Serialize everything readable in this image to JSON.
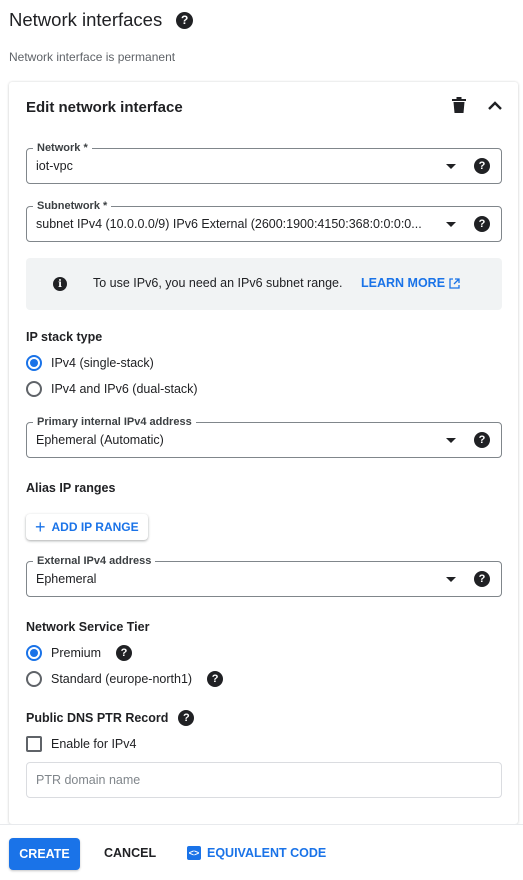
{
  "header": {
    "title": "Network interfaces",
    "subtitle": "Network interface is permanent"
  },
  "card": {
    "title": "Edit network interface",
    "network": {
      "label": "Network *",
      "value": "iot-vpc"
    },
    "subnetwork": {
      "label": "Subnetwork *",
      "value": "subnet IPv4 (10.0.0.0/9)  IPv6 External (2600:1900:4150:368:0:0:0:0..."
    },
    "info": {
      "text": "To use IPv6, you need an IPv6 subnet range.",
      "link": "LEARN MORE"
    },
    "ip_stack": {
      "label": "IP stack type",
      "options": [
        "IPv4 (single-stack)",
        "IPv4 and IPv6 (dual-stack)"
      ],
      "selected": "IPv4 (single-stack)"
    },
    "primary_ip": {
      "label": "Primary internal IPv4 address",
      "value": "Ephemeral (Automatic)"
    },
    "alias": {
      "label": "Alias IP ranges",
      "add_button": "ADD IP RANGE"
    },
    "external_ip": {
      "label": "External IPv4 address",
      "value": "Ephemeral"
    },
    "tier": {
      "label": "Network Service Tier",
      "options": [
        "Premium",
        "Standard (europe-north1)"
      ],
      "selected": "Premium"
    },
    "dns": {
      "label": "Public DNS PTR Record",
      "checkbox_label": "Enable for IPv4",
      "checked": false,
      "placeholder": "PTR domain name"
    }
  },
  "footer": {
    "create": "CREATE",
    "cancel": "CANCEL",
    "code": "EQUIVALENT CODE"
  },
  "colors": {
    "accent": "#1a73e8",
    "text": "#202124"
  }
}
